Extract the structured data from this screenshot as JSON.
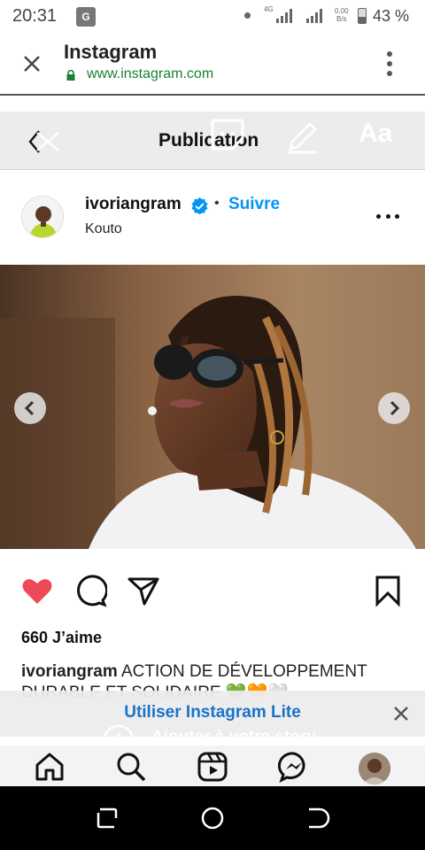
{
  "status_bar": {
    "time": "20:31",
    "translate_icon": "G",
    "network": "4G",
    "speed_value": "0.00",
    "speed_unit": "B/s",
    "battery": "43 %"
  },
  "browser": {
    "title": "Instagram",
    "url": "www.instagram.com"
  },
  "editor": {
    "title": "Publication",
    "text_tool": "Aa"
  },
  "post": {
    "username": "ivoriangram",
    "separator": "•",
    "follow_label": "Suivre",
    "location": "Kouto",
    "likes": "660 J’aime",
    "caption_user": "ivoriangram",
    "caption_text": " ACTION DE DÉVELOPPEMENT DURABLE ET SOLIDAIRE 💚🧡🤍"
  },
  "banner": {
    "lite_link": "Utiliser Instagram Lite",
    "story_label": "Ajouter à votre story"
  },
  "colors": {
    "accent_blue": "#0095f6",
    "like_red": "#ed4956",
    "url_green": "#1a7f37"
  },
  "icons": {
    "like": "heart-icon",
    "comment": "comment-icon",
    "share": "share-icon",
    "save": "bookmark-icon"
  }
}
